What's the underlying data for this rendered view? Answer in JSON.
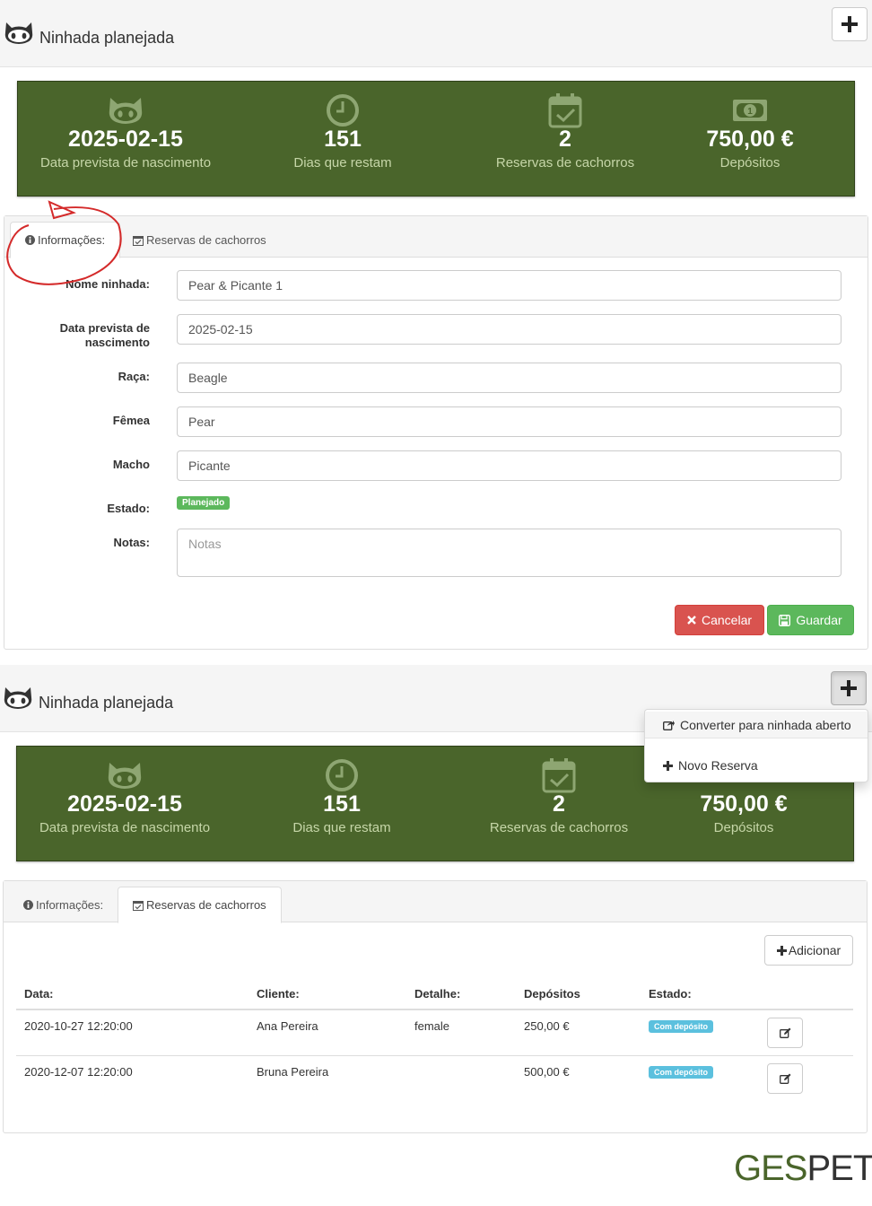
{
  "top": {
    "title": "Ninhada planejada",
    "stats": [
      {
        "value": "2025-02-15",
        "label": "Data prevista de nascimento",
        "icon": "cat-icon"
      },
      {
        "value": "151",
        "label": "Dias que restam",
        "icon": "clock-icon"
      },
      {
        "value": "2",
        "label": "Reservas de cachorros",
        "icon": "calendar-check-icon"
      },
      {
        "value": "750,00 €",
        "label": "Depósitos",
        "icon": "money-icon"
      }
    ],
    "tabs": {
      "info": "Informações:",
      "reservations": "Reservas de cachorros"
    },
    "form": {
      "name_label": "Nome ninhada:",
      "name_value": "Pear & Picante 1",
      "date_label_1": "Data prevista de",
      "date_label_2": "nascimento",
      "date_value": "2025-02-15",
      "breed_label": "Raça:",
      "breed_value": "Beagle",
      "female_label": "Fêmea",
      "female_value": "Pear",
      "male_label": "Macho",
      "male_value": "Picante",
      "status_label": "Estado:",
      "status_value": "Planejado",
      "notes_label": "Notas:",
      "notes_placeholder": "Notas"
    },
    "buttons": {
      "cancel": "Cancelar",
      "save": "Guardar"
    }
  },
  "bottom": {
    "title": "Ninhada planejada",
    "dropdown": {
      "convert": "Converter para ninhada aberto",
      "new_reservation": "Novo Reserva"
    },
    "stats": [
      {
        "value": "2025-02-15",
        "label": "Data prevista de nascimento"
      },
      {
        "value": "151",
        "label": "Dias que restam"
      },
      {
        "value": "2",
        "label": "Reservas de cachorros"
      },
      {
        "value": "750,00 €",
        "label": "Depósitos"
      }
    ],
    "tabs": {
      "info": "Informações:",
      "reservations": "Reservas de cachorros"
    },
    "add_button": "Adicionar",
    "table": {
      "headers": [
        "Data:",
        "Cliente:",
        "Detalhe:",
        "Depósitos",
        "Estado:"
      ],
      "rows": [
        {
          "date": "2020-10-27 12:20:00",
          "client": "Ana Pereira",
          "detail": "female",
          "deposit": "250,00 €",
          "status": "Com depósito"
        },
        {
          "date": "2020-12-07 12:20:00",
          "client": "Bruna Pereira",
          "detail": "",
          "deposit": "500,00 €",
          "status": "Com depósito"
        }
      ]
    }
  },
  "logo": {
    "ges": "GES",
    "pet": "PET"
  },
  "colors": {
    "banner": "#4a652b",
    "danger": "#d9534f",
    "success": "#5cb85c",
    "info": "#5bc0de",
    "annotation": "#d42a2a"
  }
}
